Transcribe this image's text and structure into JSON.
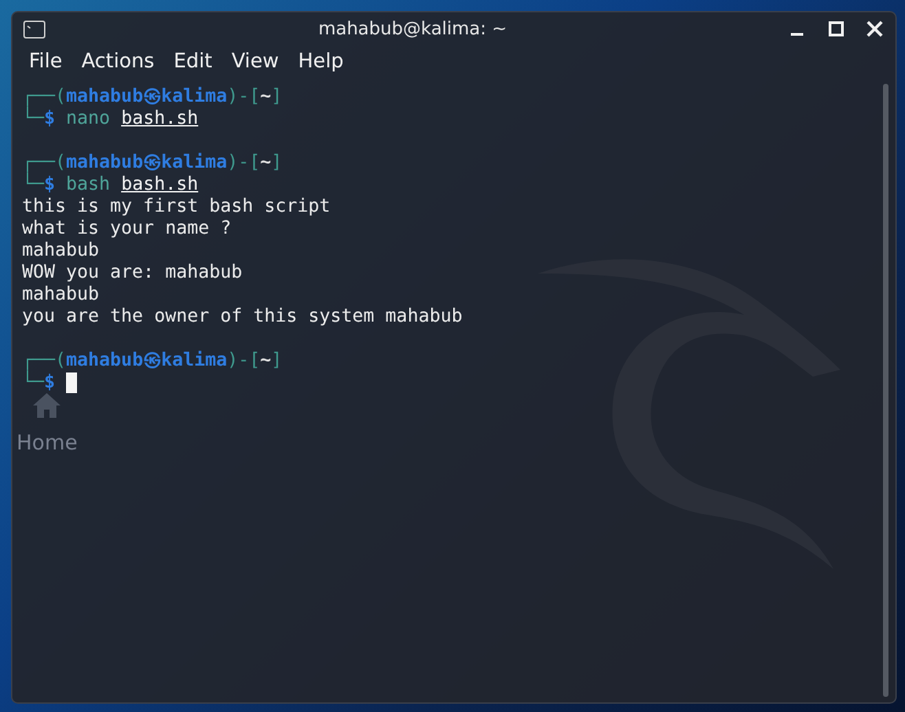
{
  "desktop": {
    "icons": [
      {
        "label": "Home"
      }
    ]
  },
  "window": {
    "title": "mahabub@kalima: ~"
  },
  "menu": [
    "File",
    "Actions",
    "Edit",
    "View",
    "Help"
  ],
  "terminal": {
    "blocks": [
      [
        [
          {
            "kind": "frame",
            "text": "┌──("
          },
          {
            "kind": "user",
            "text": "mahabub㉿kalima"
          },
          {
            "kind": "frame",
            "text": ")-["
          },
          {
            "kind": "dir",
            "text": "~"
          },
          {
            "kind": "frame",
            "text": "]"
          }
        ],
        [
          {
            "kind": "frame",
            "text": "└─"
          },
          {
            "kind": "sign",
            "text": "$"
          },
          {
            "kind": "command",
            "text": "nano"
          },
          {
            "kind": "argument",
            "text": "bash.sh"
          }
        ]
      ],
      [
        [
          {
            "kind": "frame",
            "text": "┌──("
          },
          {
            "kind": "user",
            "text": "mahabub㉿kalima"
          },
          {
            "kind": "frame",
            "text": ")-["
          },
          {
            "kind": "dir",
            "text": "~"
          },
          {
            "kind": "frame",
            "text": "]"
          }
        ],
        [
          {
            "kind": "frame",
            "text": "└─"
          },
          {
            "kind": "sign",
            "text": "$"
          },
          {
            "kind": "command",
            "text": "bash"
          },
          {
            "kind": "argument",
            "text": "bash.sh"
          }
        ],
        [
          {
            "kind": "output",
            "text": "this is my first bash script"
          }
        ],
        [
          {
            "kind": "output",
            "text": "what is your name ?"
          }
        ],
        [
          {
            "kind": "output",
            "text": "mahabub"
          }
        ],
        [
          {
            "kind": "output",
            "text": "WOW you are: mahabub"
          }
        ],
        [
          {
            "kind": "output",
            "text": "mahabub"
          }
        ],
        [
          {
            "kind": "output",
            "text": "you are the owner of this system mahabub"
          }
        ]
      ],
      [
        [
          {
            "kind": "frame",
            "text": "┌──("
          },
          {
            "kind": "user",
            "text": "mahabub㉿kalima"
          },
          {
            "kind": "frame",
            "text": ")-["
          },
          {
            "kind": "dir",
            "text": "~"
          },
          {
            "kind": "frame",
            "text": "]"
          }
        ],
        [
          {
            "kind": "frame",
            "text": "└─"
          },
          {
            "kind": "sign",
            "text": "$"
          },
          {
            "kind": "cursor"
          }
        ]
      ]
    ]
  }
}
